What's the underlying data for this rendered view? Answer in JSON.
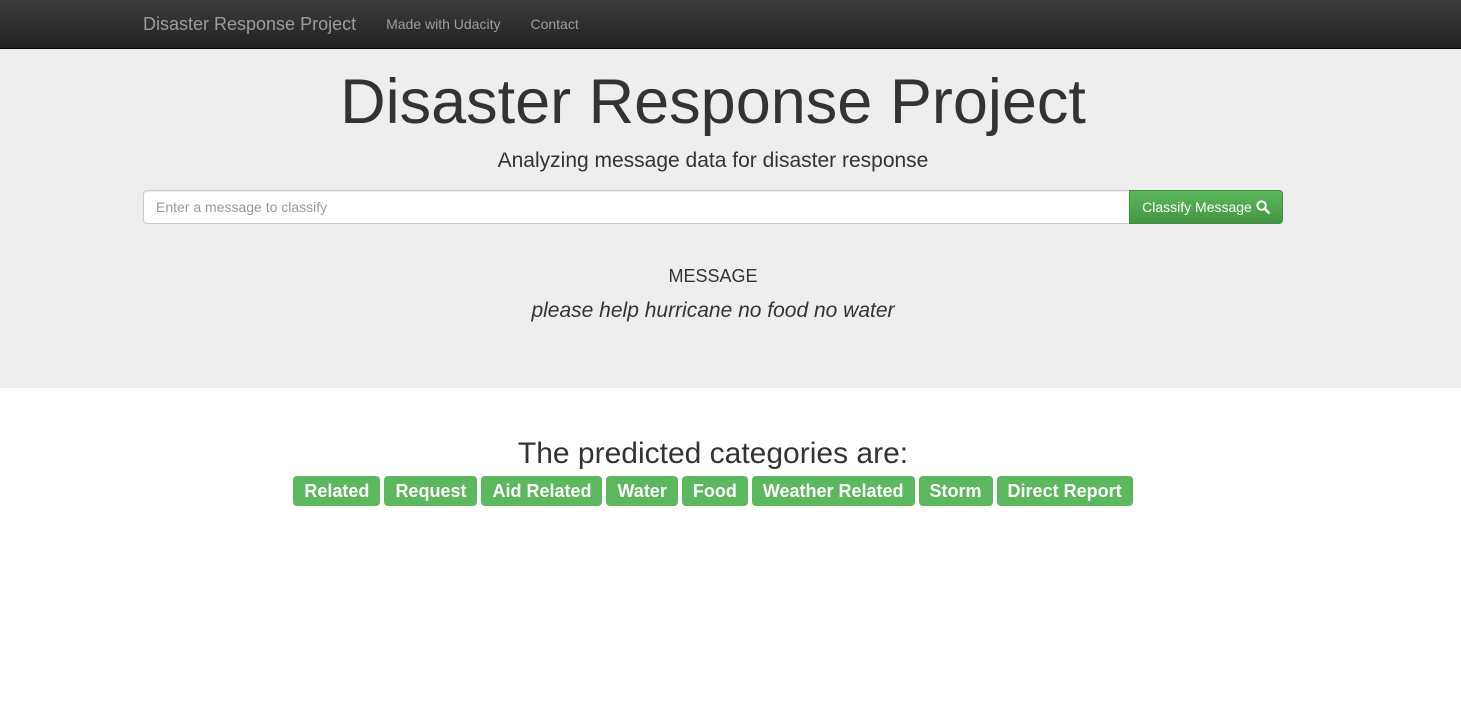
{
  "navbar": {
    "brand": "Disaster Response Project",
    "links": [
      "Made with Udacity",
      "Contact"
    ]
  },
  "jumbotron": {
    "title": "Disaster Response Project",
    "subtitle": "Analyzing message data for disaster response",
    "search": {
      "placeholder": "Enter a message to classify",
      "value": "",
      "button_label": "Classify Message",
      "button_icon": "search-icon"
    },
    "message_heading": "MESSAGE",
    "message_text": "please help hurricane no food no water"
  },
  "results": {
    "heading": "The predicted categories are:",
    "categories": [
      "Related",
      "Request",
      "Aid Related",
      "Water",
      "Food",
      "Weather Related",
      "Storm",
      "Direct Report"
    ]
  },
  "colors": {
    "navbar_bg": "#222222",
    "jumbotron_bg": "#eeeeee",
    "accent_green": "#5cb85c",
    "text": "#333333"
  }
}
